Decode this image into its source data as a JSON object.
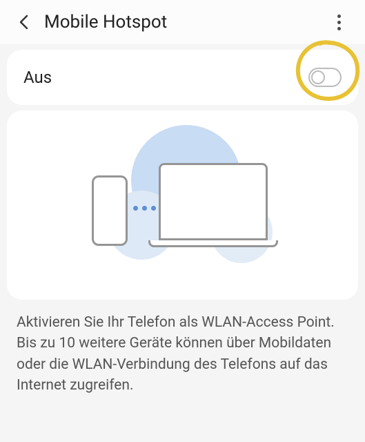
{
  "header": {
    "title": "Mobile Hotspot"
  },
  "toggle": {
    "label": "Aus",
    "state": "off"
  },
  "description": {
    "text": "Aktivieren Sie Ihr Telefon als WLAN-Access Point. Bis zu 10 weitere Geräte können über Mobildaten oder die WLAN-Verbindung des Telefons auf das Internet zugreifen."
  },
  "annotation": {
    "color": "#e8c234"
  }
}
